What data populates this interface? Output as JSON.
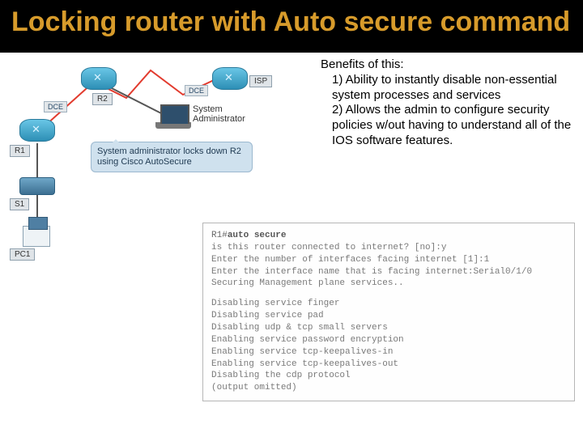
{
  "title": "Locking router with Auto secure command",
  "benefits": {
    "heading": "Benefits of this:",
    "item1": "1) Ability to instantly disable non-essential system processes and services",
    "item2": "2) Allows the admin to configure security policies w/out having to understand all of the IOS software features."
  },
  "diagram": {
    "r1": "R1",
    "r2": "R2",
    "isp": "ISP",
    "s1": "S1",
    "pc1": "PC1",
    "dce1": "DCE",
    "dce2": "DCE",
    "sysadmin": "System Administrator",
    "callout": "System administrator locks down R2 using Cisco AutoSecure"
  },
  "terminal": {
    "prompt": "R1#",
    "cmd": "auto secure",
    "l1": "is this router connected to internet? [no]:y",
    "l2": "Enter the number of interfaces facing internet [1]:1",
    "l3": "Enter the interface name that is facing internet:Serial0/1/0",
    "l4": "Securing Management plane services..",
    "l5": "Disabling service finger",
    "l6": "Disabling service pad",
    "l7": "Disabling udp & tcp small servers",
    "l8": "Enabling service password encryption",
    "l9": "Enabling service tcp-keepalives-in",
    "l10": "Enabling service tcp-keepalives-out",
    "l11": "Disabling the cdp protocol",
    "l12": "(output omitted)"
  }
}
